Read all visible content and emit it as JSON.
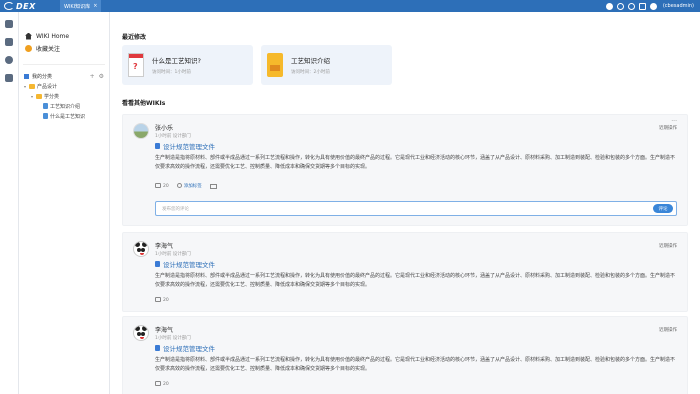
{
  "topbar": {
    "logo_text": "DEX",
    "tab_label": "WIKI知识库",
    "tab_close": "×",
    "user_name": "(cbesadmin)"
  },
  "sidebar": {
    "home_label": "WIKI Home",
    "favorites_label": "收藏关注",
    "categories_header": "我的分类",
    "add_symbol": "+",
    "settings_symbol": "⚙",
    "tree": [
      {
        "label": "产品设计",
        "caret": "▾",
        "indent": 0,
        "kind": "folder"
      },
      {
        "label": "学分类",
        "caret": "▾",
        "indent": 1,
        "kind": "folder"
      },
      {
        "label": "工艺知识介绍",
        "caret": "",
        "indent": 2,
        "kind": "doc"
      },
      {
        "label": "什么是工艺知识",
        "caret": "",
        "indent": 2,
        "kind": "doc"
      }
    ]
  },
  "main": {
    "recent_title": "最近修改",
    "recent": [
      {
        "title": "什么是工艺知识?",
        "time": "访问时间：1小时前"
      },
      {
        "title": "工艺知识介绍",
        "time": "访问时间：2小时前"
      }
    ],
    "others_title": "看看其他WIKIs",
    "cards": [
      {
        "name": "张小乐",
        "meta": "1小时前  设计部门",
        "right": "近期操作",
        "more": "···",
        "doc_title": "设计规范管理文件",
        "body": "生产制造是指将原材料、部件或半成品通过一系列工艺流程和操作，转化为具有使用价值的最终产品的过程。它是现代工业和经济活动的核心环节，涵盖了从产品设计、原材料采购、加工制造到装配、检验和包装的多个方面。生产制造不仅要求高效的操作流程，还需要优化工艺、控制质量、降低成本和确保交货期等多个目标的实现。",
        "comments": "20",
        "share_label": "添加标签",
        "comment_placeholder": "发布您的评论",
        "comment_button": "评论"
      },
      {
        "name": "李海气",
        "meta": "1小时前  设计部门",
        "right": "近期操作",
        "doc_title": "设计规范管理文件",
        "body": "生产制造是指将原材料、部件或半成品通过一系列工艺流程和操作，转化为具有使用价值的最终产品的过程。它是现代工业和经济活动的核心环节，涵盖了从产品设计、原材料采购、加工制造到装配、检验和包装的多个方面。生产制造不仅要求高效的操作流程，还需要优化工艺、控制质量、降低成本和确保交货期等多个目标的实现。",
        "comments": "20"
      },
      {
        "name": "李海气",
        "meta": "1小时前  设计部门",
        "right": "近期操作",
        "doc_title": "设计规范管理文件",
        "body": "生产制造是指将原材料、部件或半成品通过一系列工艺流程和操作，转化为具有使用价值的最终产品的过程。它是现代工业和经济活动的核心环节，涵盖了从产品设计、原材料采购、加工制造到装配、检验和包装的多个方面。生产制造不仅要求高效的操作流程，还需要优化工艺、控制质量、降低成本和确保交货期等多个目标的实现。",
        "comments": "20"
      }
    ]
  }
}
